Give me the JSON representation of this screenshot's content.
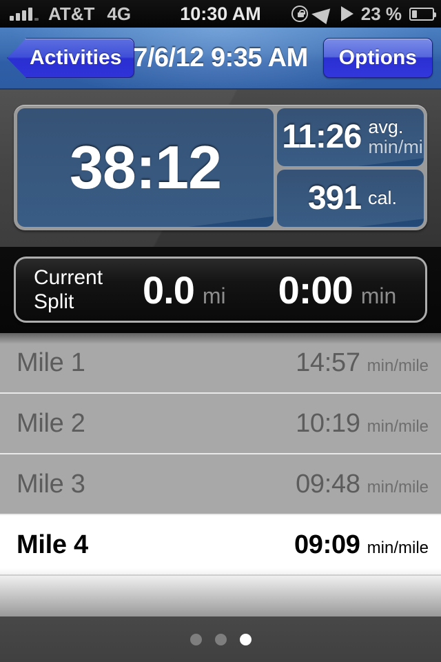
{
  "status_bar": {
    "carrier": "AT&T",
    "network": "4G",
    "time": "10:30 AM",
    "battery_percent": "23 %",
    "icons": {
      "signal": "signal-bars-icon",
      "rotation_lock": "rotation-lock-icon",
      "location": "location-arrow-icon",
      "play": "play-triangle-icon",
      "battery": "battery-icon"
    }
  },
  "nav_bar": {
    "back_label": "Activities",
    "title": "7/6/12 9:35 AM",
    "options_label": "Options"
  },
  "summary": {
    "elapsed_time": "38:12",
    "avg_pace_value": "11:26",
    "avg_pace_unit_line1": "avg.",
    "avg_pace_unit_line2": "min/mi",
    "calories_value": "391",
    "calories_unit": "cal."
  },
  "current_split": {
    "label_line1": "Current",
    "label_line2": "Split",
    "distance_value": "0.0",
    "distance_unit": "mi",
    "time_value": "0:00",
    "time_unit": "min"
  },
  "splits": {
    "unit_label": "min/mile",
    "rows": [
      {
        "name": "Mile 1",
        "pace": "14:57",
        "unit": "min/mile",
        "active": false
      },
      {
        "name": "Mile 2",
        "pace": "10:19",
        "unit": "min/mile",
        "active": false
      },
      {
        "name": "Mile 3",
        "pace": "09:48",
        "unit": "min/mile",
        "active": false
      },
      {
        "name": "Mile 4",
        "pace": "09:09",
        "unit": "min/mile",
        "active": true
      }
    ]
  },
  "page_control": {
    "total_pages": 3,
    "current_page": 3
  },
  "colors": {
    "nav_blue": "#3a6cb0",
    "button_blue": "#2f33d8",
    "panel_blue": "#234a78",
    "background_gray": "#3d3d3d",
    "row_gray": "#a8a8a8",
    "active_row": "#ffffff"
  }
}
